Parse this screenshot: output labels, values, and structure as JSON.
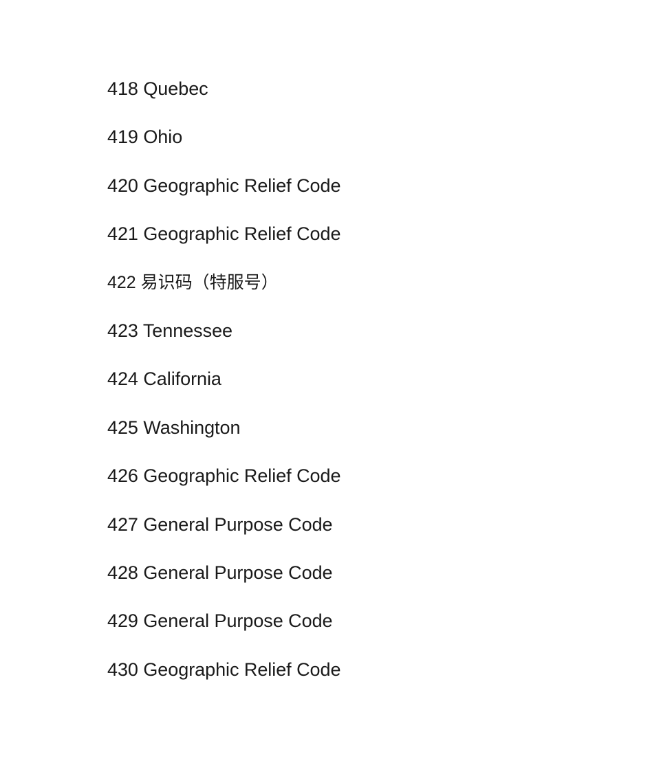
{
  "page": {
    "background_color": "#ffffff",
    "text_color": "#1a1a1a"
  },
  "document": {
    "entries": [
      {
        "number": "418",
        "label": "Quebec",
        "text": "418 Quebec"
      },
      {
        "number": "419",
        "label": "Ohio",
        "text": "419 Ohio"
      },
      {
        "number": "420",
        "label": "Geographic Relief Code",
        "text": "420 Geographic Relief Code"
      },
      {
        "number": "421",
        "label": "Geographic Relief Code",
        "text": "421 Geographic Relief Code"
      },
      {
        "number": "422",
        "label": "易识码（特服号）",
        "text": "422 易识码（特服号）"
      },
      {
        "number": "423",
        "label": "Tennessee",
        "text": "423 Tennessee"
      },
      {
        "number": "424",
        "label": "California",
        "text": "424 California"
      },
      {
        "number": "425",
        "label": "Washington",
        "text": "425 Washington"
      },
      {
        "number": "426",
        "label": "Geographic Relief Code",
        "text": "426 Geographic Relief Code"
      },
      {
        "number": "427",
        "label": "General Purpose Code",
        "text": "427 General Purpose Code"
      },
      {
        "number": "428",
        "label": "General Purpose Code",
        "text": "428 General Purpose Code"
      },
      {
        "number": "429",
        "label": "General Purpose Code",
        "text": "429 General Purpose Code"
      },
      {
        "number": "430",
        "label": "Geographic Relief Code",
        "text": "430 Geographic Relief Code"
      }
    ]
  }
}
